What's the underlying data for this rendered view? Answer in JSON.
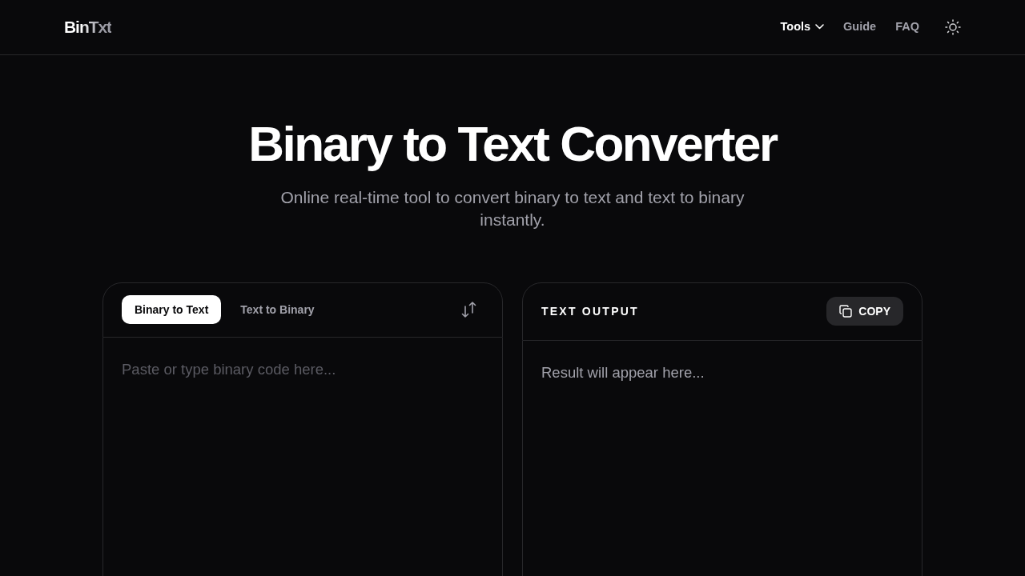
{
  "header": {
    "logo": "BinTxt",
    "nav": [
      {
        "label": "Tools",
        "kind": "dropdown",
        "selected": true
      },
      {
        "label": "Guide",
        "kind": "link",
        "selected": false
      },
      {
        "label": "FAQ",
        "kind": "link",
        "selected": false
      }
    ]
  },
  "hero": {
    "title": "Binary to Text Converter",
    "subtitle": "Online real-time tool to convert binary to text and text to binary instantly."
  },
  "input_panel": {
    "tabs": [
      {
        "label": "Binary to Text",
        "selected": true
      },
      {
        "label": "Text to Binary",
        "selected": false
      }
    ],
    "placeholder": "Paste or type binary code here..."
  },
  "output_panel": {
    "title": "TEXT OUTPUT",
    "copy_button": "COPY",
    "placeholder": "Result will appear here..."
  }
}
